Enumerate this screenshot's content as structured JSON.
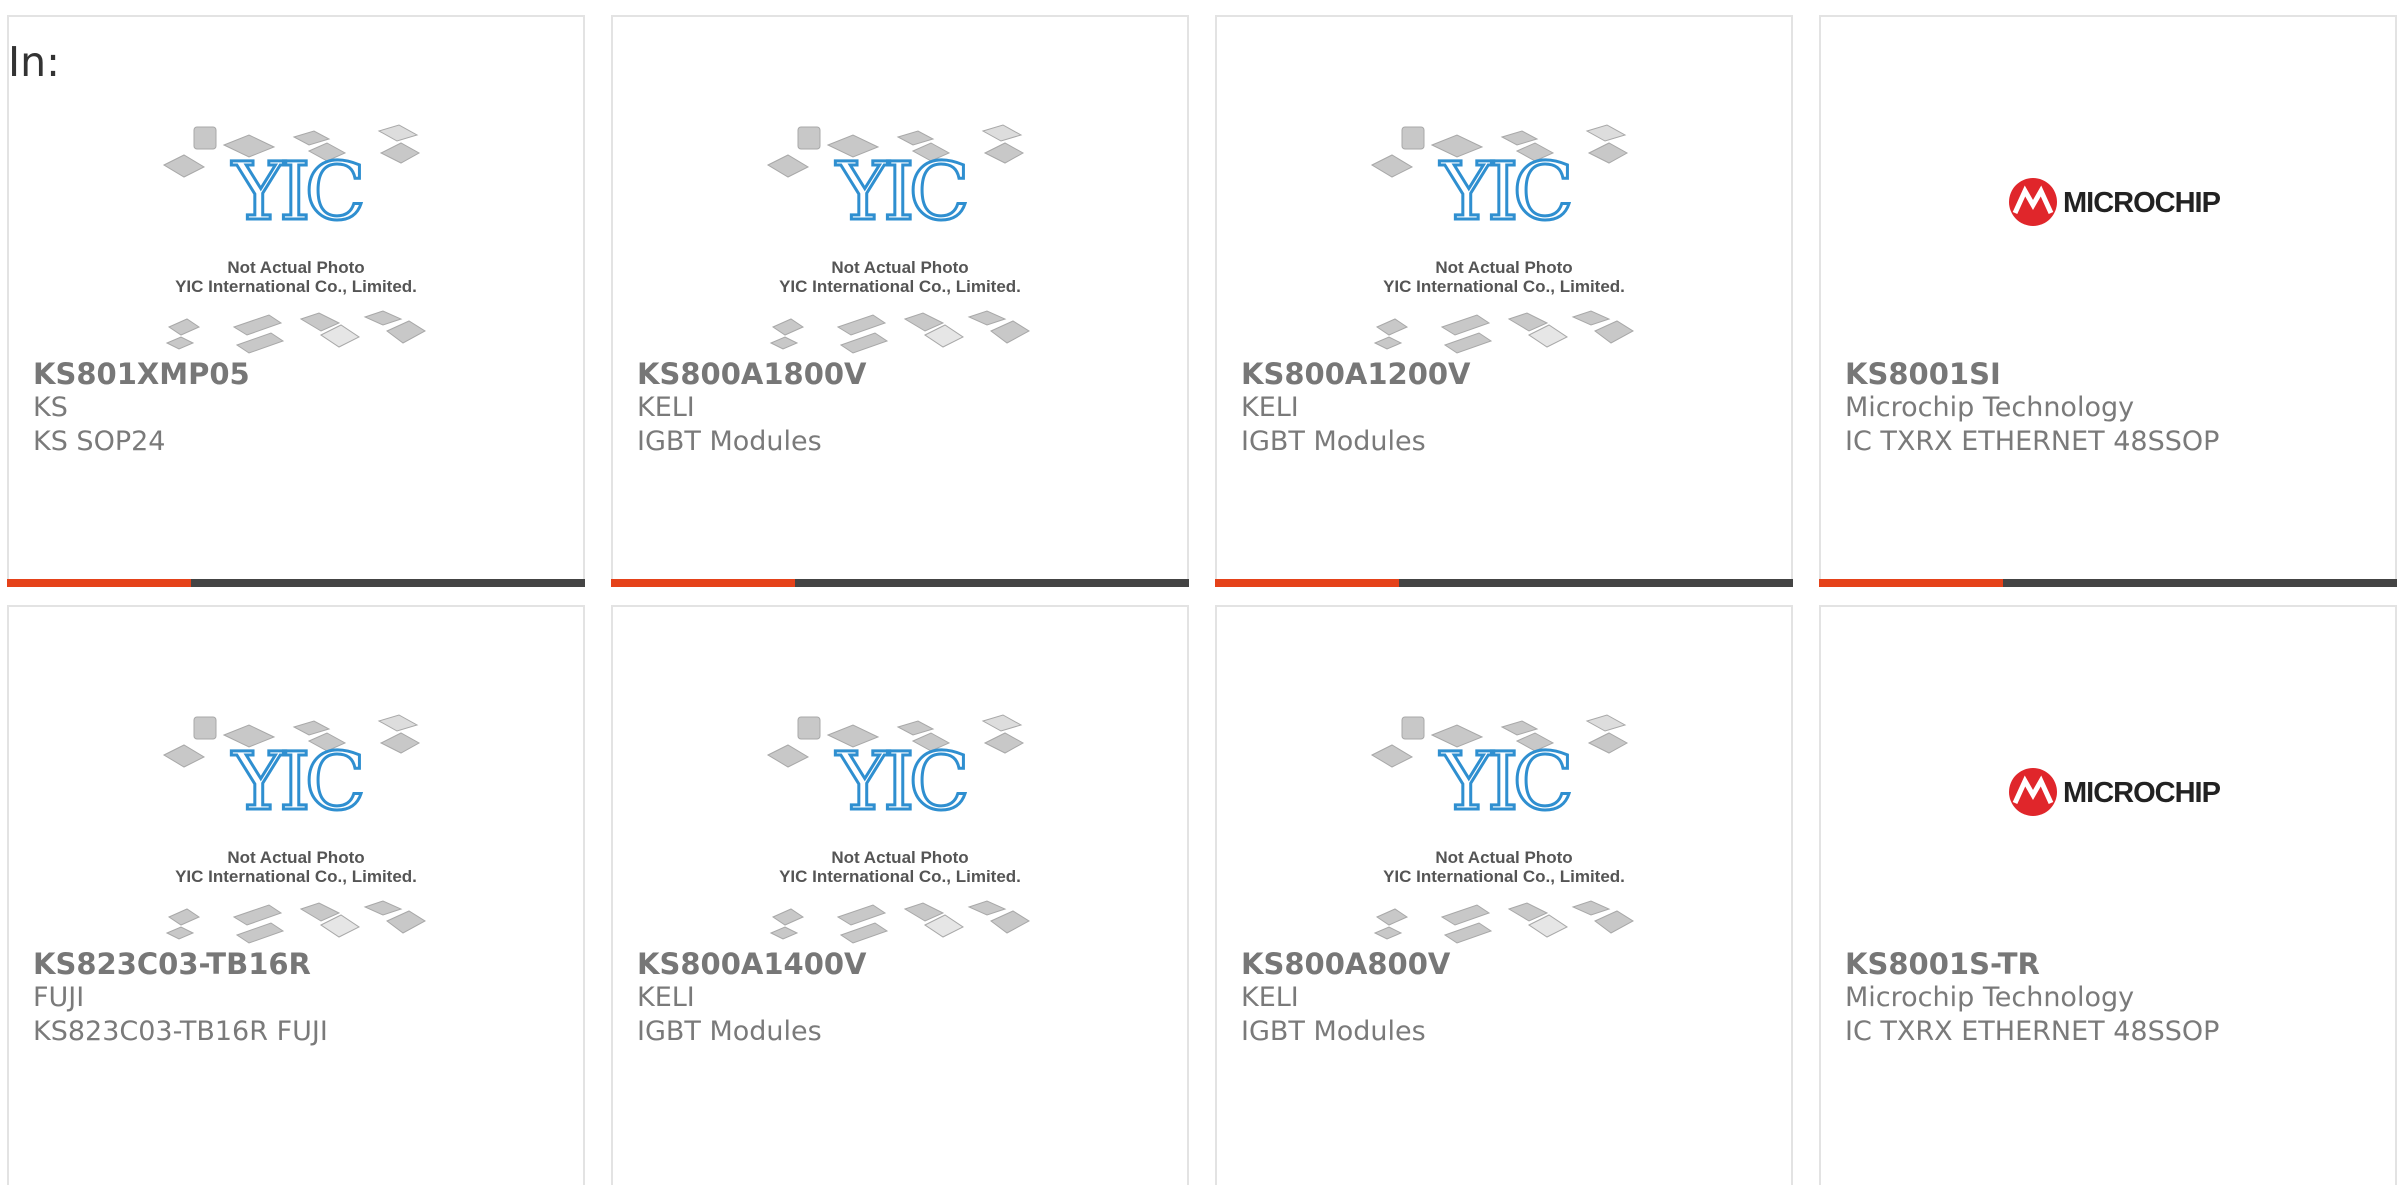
{
  "prefix_label": "In:",
  "colors": {
    "accent": "#e5421a",
    "bar": "#444444",
    "yic_blue": "#2f8fd0",
    "microchip_red": "#e0262b"
  },
  "placeholder": {
    "line1": "Not Actual Photo",
    "line2": "YIC International Co., Limited.",
    "logo_text": "YIC"
  },
  "microchip_logo_text": "MICROCHIP",
  "products": [
    {
      "pn": "KS801XMP05",
      "mfr": "KS",
      "desc": "KS SOP24",
      "image": "yic"
    },
    {
      "pn": "KS800A1800V",
      "mfr": "KELI",
      "desc": "IGBT Modules",
      "image": "yic"
    },
    {
      "pn": "KS800A1200V",
      "mfr": "KELI",
      "desc": "IGBT Modules",
      "image": "yic"
    },
    {
      "pn": "KS8001SI",
      "mfr": "Microchip Technology",
      "desc": "IC TXRX ETHERNET 48SSOP",
      "image": "microchip"
    },
    {
      "pn": "KS823C03-TB16R",
      "mfr": "FUJI",
      "desc": "KS823C03-TB16R FUJI",
      "image": "yic"
    },
    {
      "pn": "KS800A1400V",
      "mfr": "KELI",
      "desc": "IGBT Modules",
      "image": "yic"
    },
    {
      "pn": "KS800A800V",
      "mfr": "KELI",
      "desc": "IGBT Modules",
      "image": "yic"
    },
    {
      "pn": "KS8001S-TR",
      "mfr": "Microchip Technology",
      "desc": "IC TXRX ETHERNET 48SSOP",
      "image": "microchip"
    }
  ]
}
